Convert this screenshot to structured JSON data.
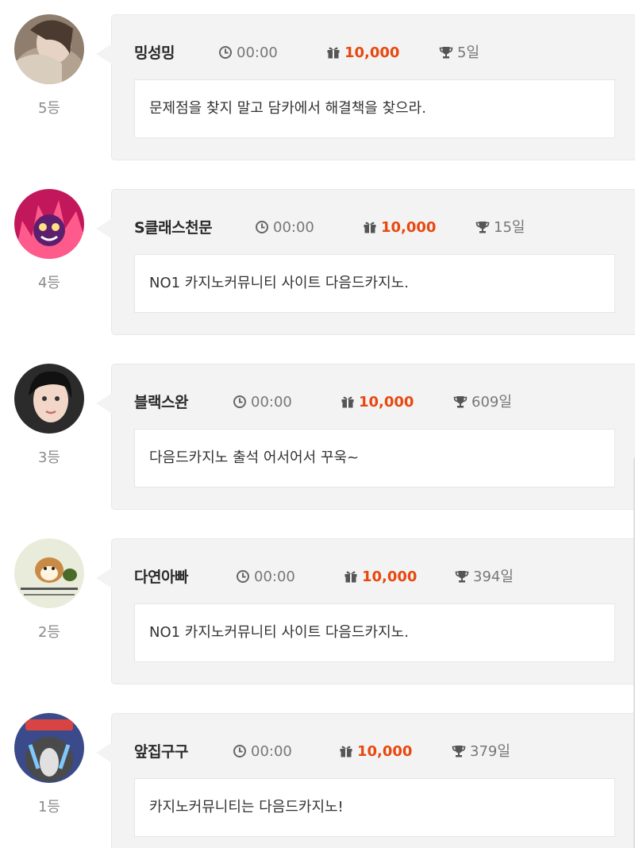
{
  "entries": [
    {
      "nickname": "밍성밍",
      "time": "00:00",
      "points": "10,000",
      "days": "5일",
      "message": "문제점을 찾지 말고 담카에서 해결책을 찾으라.",
      "rank": "5등",
      "avatar": "avatar-woman-scarf"
    },
    {
      "nickname": "S클래스천문",
      "time": "00:00",
      "points": "10,000",
      "days": "15일",
      "message": "NO1 카지노커뮤니티 사이트 다음드카지노.",
      "rank": "4등",
      "avatar": "avatar-anime-fire"
    },
    {
      "nickname": "블랙스완",
      "time": "00:00",
      "points": "10,000",
      "days": "609일",
      "message": "다음드카지노 출석 어서어서 꾸욱~",
      "rank": "3등",
      "avatar": "avatar-woman-portrait"
    },
    {
      "nickname": "다연아빠",
      "time": "00:00",
      "points": "10,000",
      "days": "394일",
      "message": "NO1 카지노커뮤니티 사이트 다음드카지노.",
      "rank": "2등",
      "avatar": "avatar-hamster-meme"
    },
    {
      "nickname": "앞집구구",
      "time": "00:00",
      "points": "10,000",
      "days": "379일",
      "message": "카지노커뮤니티는 다음드카지노!",
      "rank": "1등",
      "avatar": "avatar-crying-character"
    }
  ],
  "colors": {
    "points": "#e8480f",
    "card_bg": "#f3f3f3",
    "muted": "#777777",
    "nickname": "#2a2a2a"
  },
  "icons": {
    "time": "clock-icon",
    "points": "gift-icon",
    "days": "trophy-icon"
  }
}
